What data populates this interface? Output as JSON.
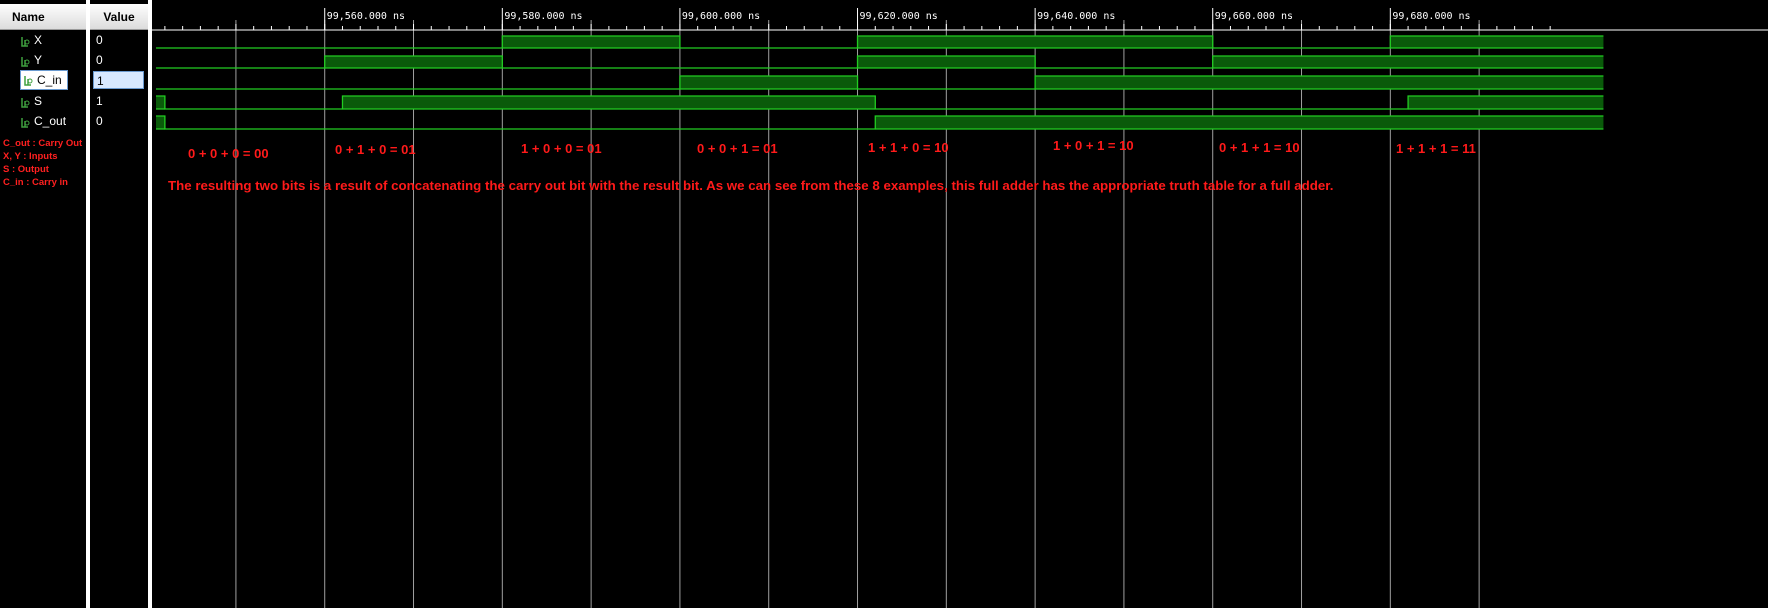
{
  "columns": {
    "name_header": "Name",
    "value_header": "Value"
  },
  "signals": [
    {
      "name": "X",
      "value": "0",
      "selected": false
    },
    {
      "name": "Y",
      "value": "0",
      "selected": false
    },
    {
      "name": "C_in",
      "value": "1",
      "selected": true
    },
    {
      "name": "S",
      "value": "1",
      "selected": false
    },
    {
      "name": "C_out",
      "value": "0",
      "selected": false
    }
  ],
  "legend": [
    "C_out : Carry Out",
    "X, Y : Inputs",
    "S : Output",
    "C_in : Carry in"
  ],
  "timeline": {
    "unit": "ns",
    "major_labels": [
      "99,560.000 ns",
      "99,580.000 ns",
      "99,600.000 ns",
      "99,620.000 ns",
      "99,640.000 ns",
      "99,660.000 ns",
      "99,680.000 ns"
    ],
    "major_times": [
      99560,
      99580,
      99600,
      99620,
      99640,
      99660,
      99680
    ],
    "visible_start": 99541,
    "visible_end": 99699
  },
  "waveforms": {
    "X": [
      [
        99541,
        0
      ],
      [
        99580,
        1
      ],
      [
        99600,
        0
      ],
      [
        99620,
        1
      ],
      [
        99660,
        0
      ],
      [
        99680,
        1
      ]
    ],
    "Y": [
      [
        99541,
        0
      ],
      [
        99560,
        1
      ],
      [
        99580,
        0
      ],
      [
        99620,
        1
      ],
      [
        99640,
        0
      ],
      [
        99660,
        1
      ]
    ],
    "C_in": [
      [
        99541,
        0
      ],
      [
        99600,
        1
      ],
      [
        99620,
        0
      ],
      [
        99640,
        1
      ]
    ],
    "S": [
      [
        99541,
        1
      ],
      [
        99542,
        0
      ],
      [
        99562,
        1
      ],
      [
        99622,
        0
      ],
      [
        99682,
        1
      ]
    ],
    "C_out": [
      [
        99541,
        1
      ],
      [
        99542,
        0
      ],
      [
        99622,
        1
      ]
    ]
  },
  "annotations": {
    "equations": [
      "0 + 0 + 0 = 00",
      "0 + 1 + 0 = 01",
      "1 + 0 + 0 = 01",
      "0 + 0 + 1 = 01",
      "1 + 1 + 0 = 10",
      "1 + 0 + 1 = 10",
      "0 + 1 + 1 = 10",
      "1 + 1 + 1 = 11"
    ],
    "summary": "The resulting two bits is a result of concatenating the carry out bit with the result bit. As we can see from these 8 examples, this full adder has the appropriate truth table for a full adder."
  },
  "colors": {
    "wave": "#22cc22",
    "wave_fill": "#0a5a0a",
    "annotation": "#ff1a1a",
    "grid": "#bdbdbd"
  }
}
